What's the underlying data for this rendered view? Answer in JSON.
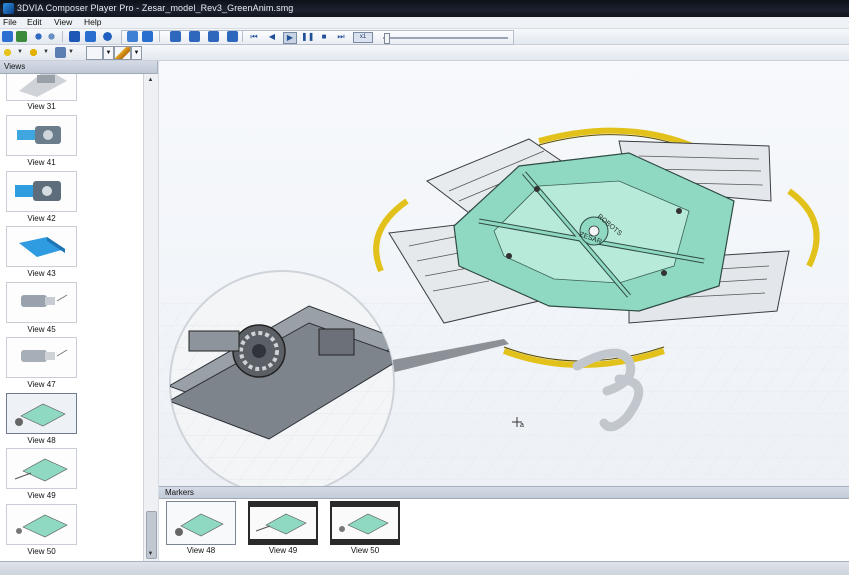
{
  "window": {
    "title": "3DVIA Composer Player Pro - Zesar_model_Rev3_GreenAnim.smg"
  },
  "menu": [
    "File",
    "Edit",
    "View",
    "Help"
  ],
  "views_panel": {
    "title": "Views",
    "items": [
      {
        "label": "View 31"
      },
      {
        "label": "View 41"
      },
      {
        "label": "View 42"
      },
      {
        "label": "View 43"
      },
      {
        "label": "View 45"
      },
      {
        "label": "View 47"
      },
      {
        "label": "View 48",
        "selected": true
      },
      {
        "label": "View 49"
      },
      {
        "label": "View 50"
      }
    ]
  },
  "viewport": {
    "plate_text": [
      "ROBOTS",
      "ZESAR"
    ]
  },
  "markers_panel": {
    "title": "Markers",
    "items": [
      {
        "label": "View 48"
      },
      {
        "label": "View 49"
      },
      {
        "label": "View 50"
      }
    ]
  },
  "colors": {
    "plate": "#8fd9c2",
    "ring": "#e2c21a",
    "titlebar": "#141a24",
    "accent": "#2a6fcf"
  },
  "icons": [
    "app-icon",
    "open-icon",
    "save-icon",
    "undo-icon",
    "redo-icon",
    "grid-icon",
    "info-icon",
    "rotate-icon",
    "zoom-icon",
    "camera-icon",
    "first-frame-icon",
    "prev-frame-icon",
    "play-icon",
    "pause-icon",
    "stop-icon",
    "next-frame-icon",
    "speed-icon",
    "time-slider",
    "light-icon",
    "render-mode-icon",
    "pan-icon",
    "select-icon",
    "ds-logo-watermark",
    "cursor-icon"
  ]
}
